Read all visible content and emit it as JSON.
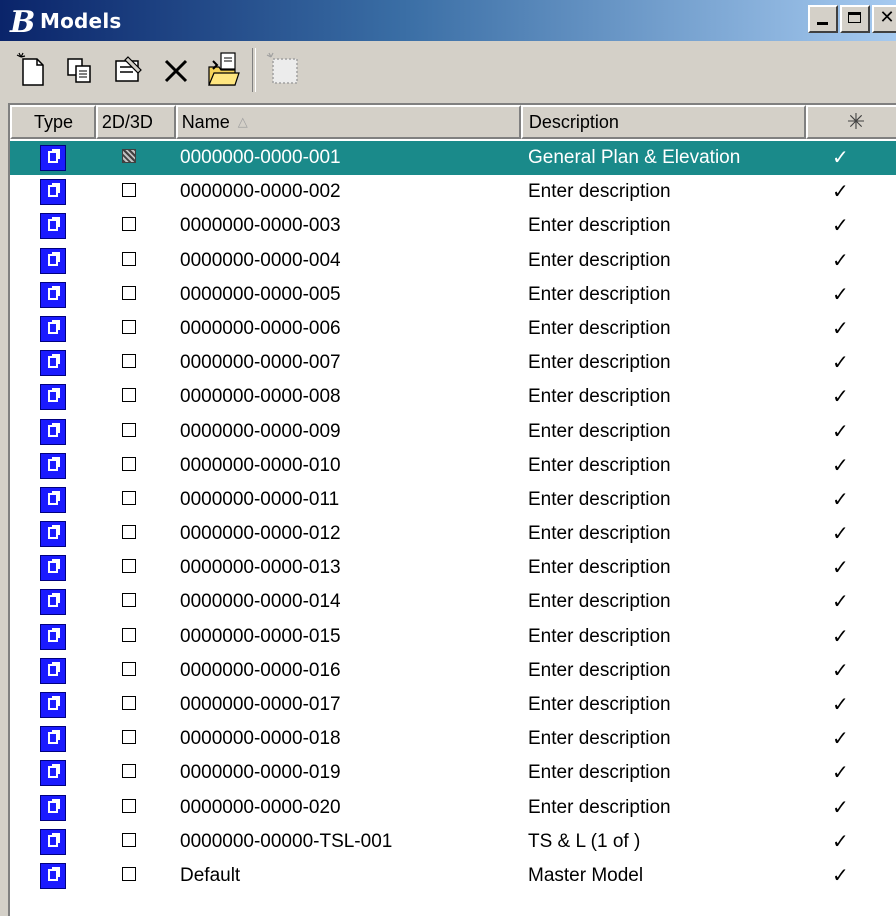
{
  "window": {
    "title": "Models"
  },
  "toolbar": {
    "buttons": [
      {
        "name": "create-model",
        "icon": "new-document-icon"
      },
      {
        "name": "copy-model",
        "icon": "copy-icon"
      },
      {
        "name": "model-properties",
        "icon": "properties-icon"
      },
      {
        "name": "delete-model",
        "icon": "delete-icon"
      },
      {
        "name": "import-model",
        "icon": "import-folder-icon"
      },
      {
        "name": "create-from-seed",
        "icon": "disabled-model-icon"
      }
    ]
  },
  "columns": {
    "type": "Type",
    "dimension": "2D/3D",
    "name": "Name",
    "name_sort_indicator": "△",
    "description": "Description",
    "visible_icon": "✳"
  },
  "rows": [
    {
      "name": "0000000-0000-001",
      "description": "General Plan & Elevation",
      "check": "✓",
      "selected": true
    },
    {
      "name": "0000000-0000-002",
      "description": "Enter description",
      "check": "✓"
    },
    {
      "name": "0000000-0000-003",
      "description": "Enter description",
      "check": "✓"
    },
    {
      "name": "0000000-0000-004",
      "description": "Enter description",
      "check": "✓"
    },
    {
      "name": "0000000-0000-005",
      "description": "Enter description",
      "check": "✓"
    },
    {
      "name": "0000000-0000-006",
      "description": "Enter description",
      "check": "✓"
    },
    {
      "name": "0000000-0000-007",
      "description": "Enter description",
      "check": "✓"
    },
    {
      "name": "0000000-0000-008",
      "description": "Enter description",
      "check": "✓"
    },
    {
      "name": "0000000-0000-009",
      "description": "Enter description",
      "check": "✓"
    },
    {
      "name": "0000000-0000-010",
      "description": "Enter description",
      "check": "✓"
    },
    {
      "name": "0000000-0000-011",
      "description": "Enter description",
      "check": "✓"
    },
    {
      "name": "0000000-0000-012",
      "description": "Enter description",
      "check": "✓"
    },
    {
      "name": "0000000-0000-013",
      "description": "Enter description",
      "check": "✓"
    },
    {
      "name": "0000000-0000-014",
      "description": "Enter description",
      "check": "✓"
    },
    {
      "name": "0000000-0000-015",
      "description": "Enter description",
      "check": "✓"
    },
    {
      "name": "0000000-0000-016",
      "description": "Enter description",
      "check": "✓"
    },
    {
      "name": "0000000-0000-017",
      "description": "Enter description",
      "check": "✓"
    },
    {
      "name": "0000000-0000-018",
      "description": "Enter description",
      "check": "✓"
    },
    {
      "name": "0000000-0000-019",
      "description": "Enter description",
      "check": "✓"
    },
    {
      "name": "0000000-0000-020",
      "description": "Enter description",
      "check": "✓"
    },
    {
      "name": "0000000-00000-TSL-001",
      "description": "TS & L (1 of )",
      "check": "✓"
    },
    {
      "name": "Default",
      "description": "Master Model",
      "check": "✓"
    }
  ],
  "colors": {
    "titlebar_start": "#0a246a",
    "titlebar_end": "#a6caf0",
    "selection": "#1a8a8a",
    "type_icon": "#1a1aff",
    "chrome": "#d4d0c8"
  }
}
